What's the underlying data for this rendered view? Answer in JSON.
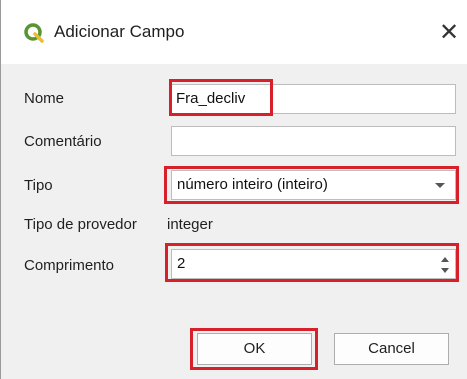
{
  "window": {
    "title": "Adicionar Campo",
    "app_icon": "qgis-logo-icon",
    "close_glyph": "✕"
  },
  "form": {
    "name_label": "Nome",
    "name_value": "Fra_decliv",
    "comment_label": "Comentário",
    "comment_value": "",
    "type_label": "Tipo",
    "type_value": "número inteiro (inteiro)",
    "provider_type_label": "Tipo de provedor",
    "provider_type_value": "integer",
    "length_label": "Comprimento",
    "length_value": "2"
  },
  "buttons": {
    "ok": "OK",
    "cancel": "Cancel"
  },
  "colors": {
    "highlight": "#d6212b",
    "qgis_green": "#589632",
    "qgis_yellow": "#eebc2f"
  }
}
